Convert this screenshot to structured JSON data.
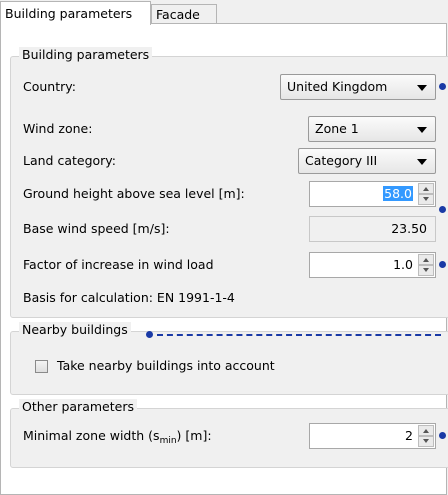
{
  "tabs": [
    {
      "label": "Building parameters",
      "active": true
    },
    {
      "label": "Facade",
      "active": false
    }
  ],
  "building_parameters": {
    "title": "Building parameters",
    "country_label": "Country:",
    "country_value": "United Kingdom",
    "wind_zone_label": "Wind zone:",
    "wind_zone_value": "Zone 1",
    "land_category_label": "Land category:",
    "land_category_value": "Category III",
    "ground_height_label": "Ground height above sea level [m]:",
    "ground_height_value": "58.0",
    "base_wind_label": "Base wind speed [m/s]:",
    "base_wind_value": "23.50",
    "factor_label": "Factor of increase in wind load",
    "factor_value": "1.0",
    "basis_text": "Basis for calculation: EN 1991-1-4"
  },
  "nearby_buildings": {
    "title": "Nearby buildings",
    "checkbox_label": "Take nearby buildings into account",
    "checked": false
  },
  "other_parameters": {
    "title": "Other parameters",
    "min_zone_label_pre": "Minimal zone width (s",
    "min_zone_label_sub": "min",
    "min_zone_label_post": ") [m]:",
    "min_zone_value": "2"
  },
  "colors": {
    "accent": "#1a3aa6",
    "selection": "#3399ff"
  }
}
